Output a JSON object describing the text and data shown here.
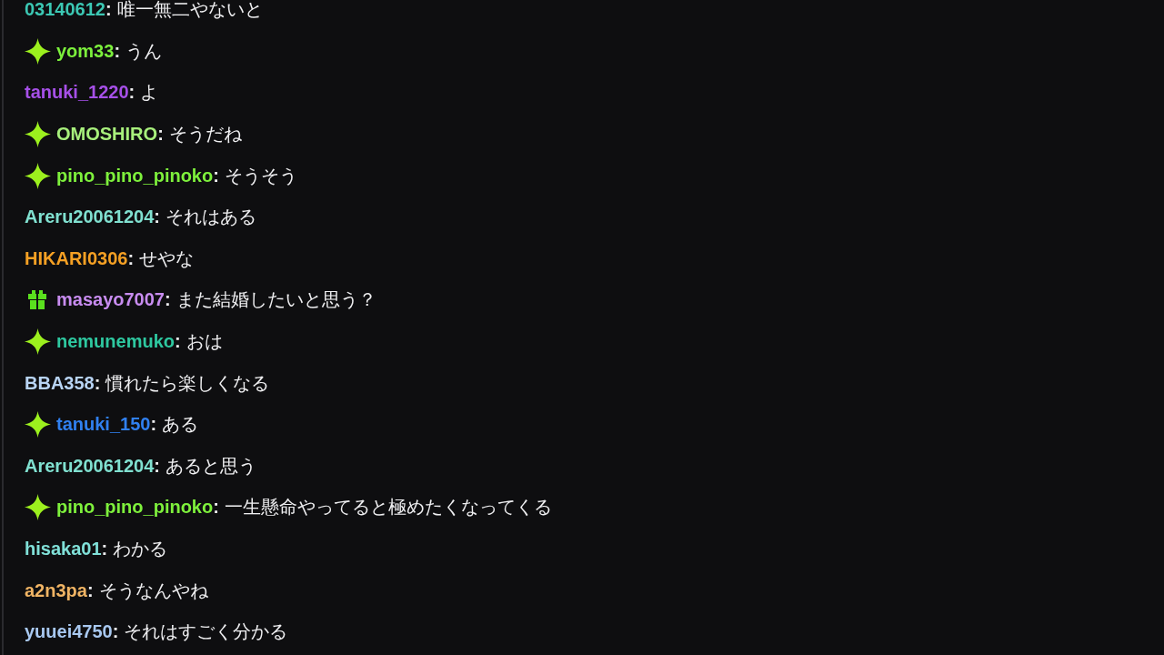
{
  "chat": {
    "messages": [
      {
        "user": "03140612",
        "color": "#3cc8b4",
        "kind": "plain",
        "separator": ":",
        "text": "唯一無二やないと"
      },
      {
        "user": "yom33",
        "color": "#7cf03c",
        "kind": "sparkle",
        "separator": ":",
        "text": "うん"
      },
      {
        "user": "tanuki_1220",
        "color": "#a650e8",
        "kind": "plain",
        "separator": ":",
        "text": "よ"
      },
      {
        "user": "OMOSHIRO",
        "color": "#a8f07c",
        "kind": "sparkle",
        "separator": ":",
        "text": "そうだね"
      },
      {
        "user": "pino_pino_pinoko",
        "color": "#7ef03c",
        "kind": "sparkle",
        "separator": ":",
        "text": "そうそう"
      },
      {
        "user": "Areru20061204",
        "color": "#80e0d0",
        "kind": "plain",
        "separator": ":",
        "text": "それはある"
      },
      {
        "user": "HIKARI0306",
        "color": "#f5a024",
        "kind": "plain",
        "separator": ":",
        "text": "せやな"
      },
      {
        "user": "masayo7007",
        "color": "#c88cf0",
        "kind": "gift",
        "separator": ":",
        "text": "また結婚したいと思う？"
      },
      {
        "user": "nemunemuko",
        "color": "#2ec8a0",
        "kind": "sparkle",
        "separator": ":",
        "text": "おは"
      },
      {
        "user": "BBA358",
        "color": "#b8d4f4",
        "kind": "plain",
        "separator": ":",
        "text": "慣れたら楽しくなる"
      },
      {
        "user": "tanuki_150",
        "color": "#3080f0",
        "kind": "sparkle",
        "separator": ":",
        "text": "ある"
      },
      {
        "user": "Areru20061204",
        "color": "#80e0d0",
        "kind": "plain",
        "separator": ":",
        "text": "あると思う"
      },
      {
        "user": "pino_pino_pinoko",
        "color": "#7ef03c",
        "kind": "sparkle",
        "separator": ":",
        "text": "一生懸命やってると極めたくなってくる"
      },
      {
        "user": "hisaka01",
        "color": "#80e0d8",
        "kind": "plain",
        "separator": ":",
        "text": "わかる"
      },
      {
        "user": "a2n3pa",
        "color": "#f0b464",
        "kind": "plain",
        "separator": ":",
        "text": "そうなんやね"
      },
      {
        "user": "yuuei4750",
        "color": "#a8c8f0",
        "kind": "plain",
        "separator": ":",
        "text": "それはすごく分かる"
      }
    ]
  }
}
